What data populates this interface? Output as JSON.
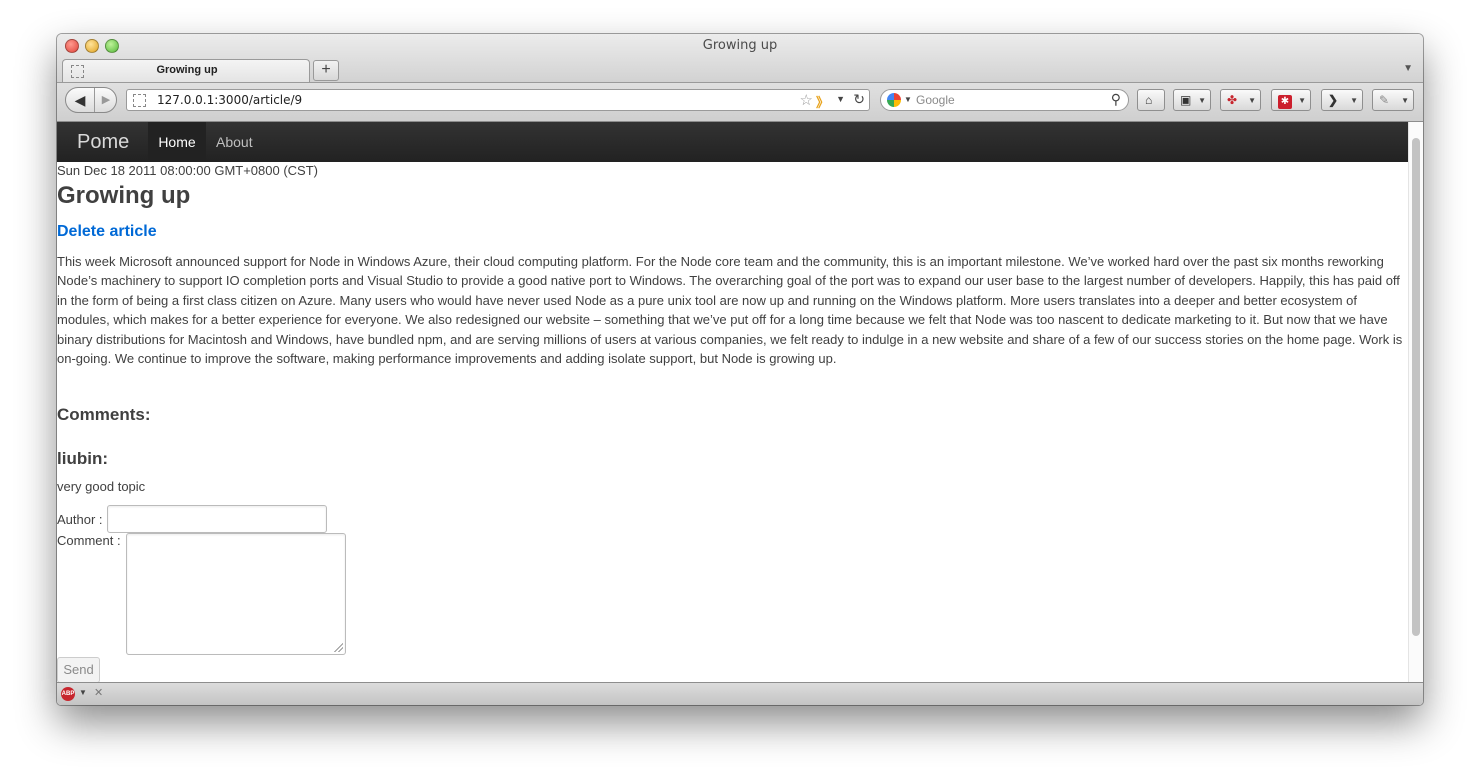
{
  "window": {
    "title": "Growing up"
  },
  "tabs": [
    {
      "label": "Growing up"
    }
  ],
  "browser": {
    "new_tab_label": "+",
    "url": "127.0.0.1:3000/article/9",
    "search_placeholder": "Google"
  },
  "nav": {
    "brand": "Pome",
    "items": [
      {
        "label": "Home",
        "active": true
      },
      {
        "label": "About",
        "active": false
      }
    ]
  },
  "article": {
    "date": "Sun Dec 18 2011 08:00:00 GMT+0800 (CST)",
    "title": "Growing up",
    "delete_label": "Delete article",
    "body": "This week Microsoft announced support for Node in Windows Azure, their cloud computing platform. For the Node core team and the community, this is an important milestone. We’ve worked hard over the past six months reworking Node’s machinery to support IO completion ports and Visual Studio to provide a good native port to Windows. The overarching goal of the port was to expand our user base to the largest number of developers. Happily, this has paid off in the form of being a first class citizen on Azure. Many users who would have never used Node as a pure unix tool are now up and running on the Windows platform. More users translates into a deeper and better ecosystem of modules, which makes for a better experience for everyone. We also redesigned our website – something that we’ve put off for a long time because we felt that Node was too nascent to dedicate marketing to it. But now that we have binary distributions for Macintosh and Windows, have bundled npm, and are serving millions of users at various companies, we felt ready to indulge in a new website and share of a few of our success stories on the home page. Work is on-going. We continue to improve the software, making performance improvements and adding isolate support, but Node is growing up."
  },
  "comments": {
    "heading": "Comments:",
    "items": [
      {
        "author": "liubin:",
        "text": "very good topic"
      }
    ]
  },
  "form": {
    "author_label": "Author :",
    "author_value": "",
    "comment_label": "Comment :",
    "comment_value": "",
    "send_label": "Send"
  },
  "statusbar": {
    "addon": "ABP"
  }
}
